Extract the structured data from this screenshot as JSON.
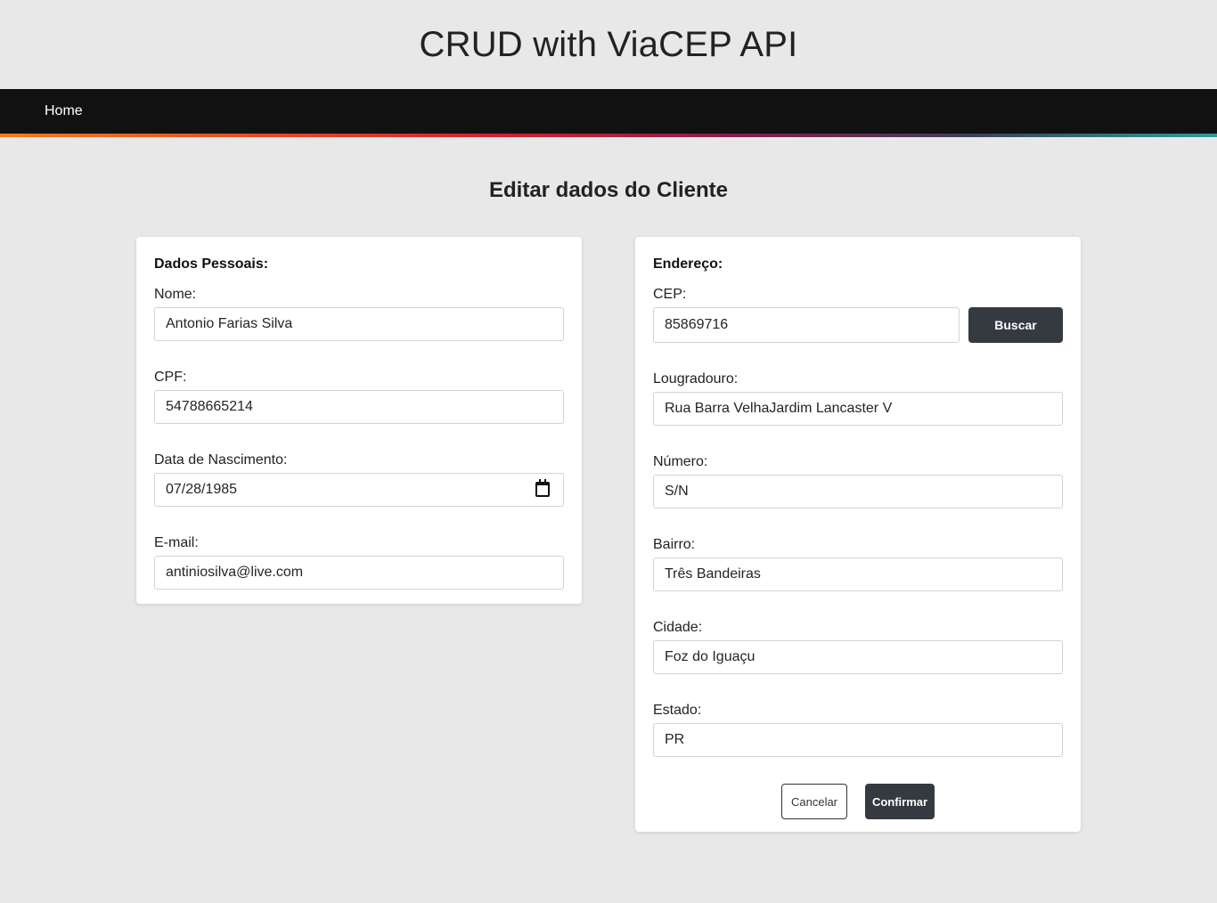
{
  "header": {
    "title": "CRUD with ViaCEP API"
  },
  "nav": {
    "home_label": "Home"
  },
  "page": {
    "heading": "Editar dados do Cliente"
  },
  "personal": {
    "title": "Dados Pessoais:",
    "nome": {
      "label": "Nome:",
      "value": "Antonio Farias Silva"
    },
    "cpf": {
      "label": "CPF:",
      "value": "54788665214"
    },
    "nascimento": {
      "label": "Data de Nascimento:",
      "value": "07/28/1985",
      "icon": "calendar-icon"
    },
    "email": {
      "label": "E-mail:",
      "value": "antiniosilva@live.com"
    }
  },
  "address": {
    "title": "Endereço:",
    "cep": {
      "label": "CEP:",
      "value": "85869716",
      "button_label": "Buscar"
    },
    "logradouro": {
      "label": "Lougradouro:",
      "value": "Rua Barra VelhaJardim Lancaster V"
    },
    "numero": {
      "label": "Número:",
      "value": "S/N"
    },
    "bairro": {
      "label": "Bairro:",
      "value": "Três Bandeiras"
    },
    "cidade": {
      "label": "Cidade:",
      "value": "Foz do Iguaçu"
    },
    "estado": {
      "label": "Estado:",
      "value": "PR"
    }
  },
  "actions": {
    "cancel_label": "Cancelar",
    "confirm_label": "Confirmar"
  },
  "colors": {
    "background": "#e8e8e8",
    "navbar": "#111111",
    "dark_button": "#343a40",
    "accent_gradient": [
      "#f07c1c",
      "#d8202e",
      "#8a1b4a",
      "#3a3f5c",
      "#2a9d9a"
    ]
  }
}
